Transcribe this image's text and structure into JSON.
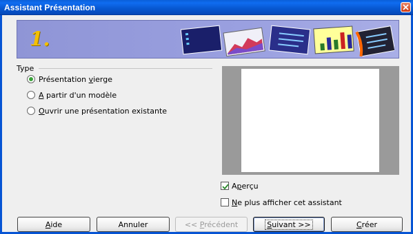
{
  "window": {
    "title": "Assistant Présentation",
    "close_icon": "close-icon"
  },
  "banner": {
    "step": "1."
  },
  "type_group": {
    "label": "Type",
    "options": [
      {
        "before": "Présentation ",
        "mnemonic": "v",
        "after": "ierge",
        "checked": true
      },
      {
        "before": "",
        "mnemonic": "A",
        "after": " partir d'un modèle",
        "checked": false
      },
      {
        "before": "",
        "mnemonic": "O",
        "after": "uvrir une présentation existante",
        "checked": false
      }
    ]
  },
  "preview": {
    "checkbox_before": "A",
    "checkbox_mnemonic": "p",
    "checkbox_after": "erçu",
    "checked": true
  },
  "no_show": {
    "mnemonic": "N",
    "after": "e plus afficher cet assistant",
    "checked": false
  },
  "buttons": {
    "help": {
      "mnemonic": "A",
      "after": "ide"
    },
    "cancel": "Annuler",
    "previous": {
      "before": "<< ",
      "mnemonic": "P",
      "after": "récédent"
    },
    "next": {
      "mnemonic": "S",
      "after": "uivant >>"
    },
    "create": {
      "mnemonic": "C",
      "after": "réer"
    }
  },
  "colors": {
    "title_bar": "#0757d0",
    "banner": "#9aa0e0",
    "step_number": "#f4c000",
    "radio_selected": "#3aa23a"
  }
}
